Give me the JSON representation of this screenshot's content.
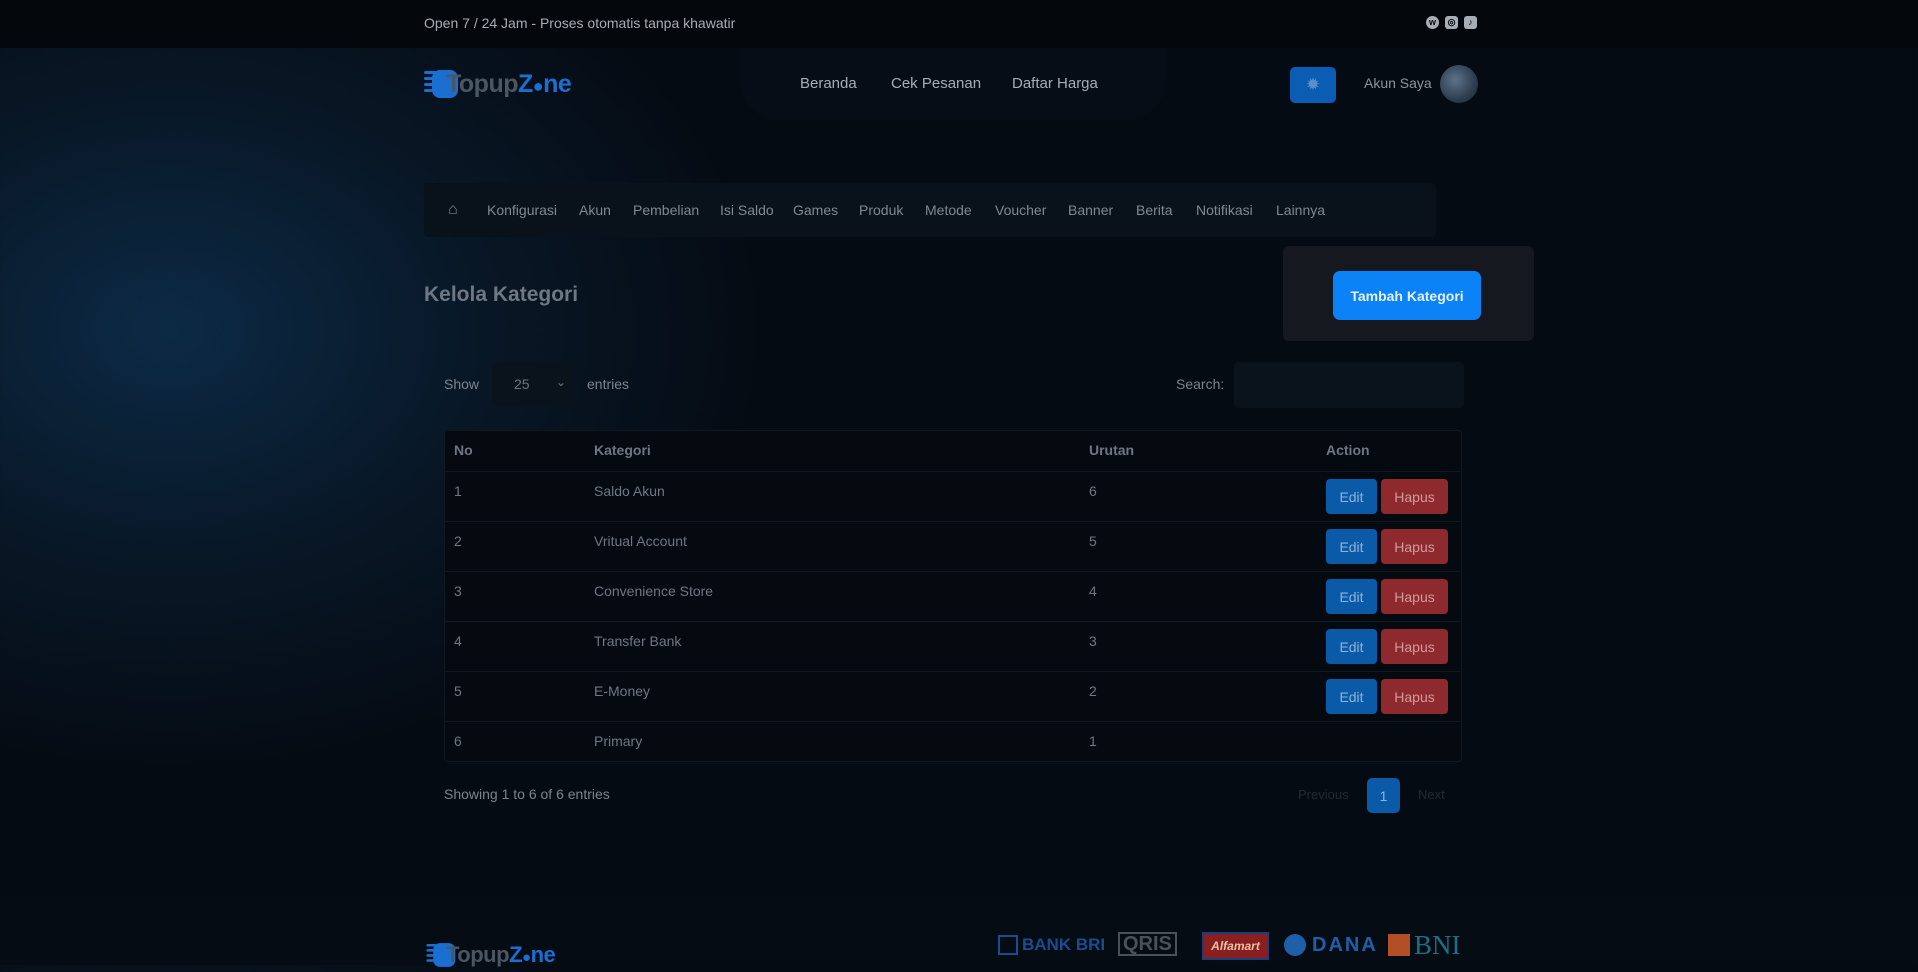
{
  "topbar": {
    "tagline": "Open 7 / 24 Jam - Proses otomatis tanpa khawatir"
  },
  "brand": {
    "name_part1": "Topup",
    "name_part2": "Z",
    "name_part3": "ne"
  },
  "nav": [
    {
      "label": "Beranda"
    },
    {
      "label": "Cek Pesanan"
    },
    {
      "label": "Daftar Harga"
    }
  ],
  "account": {
    "label": "Akun Saya"
  },
  "admin_menu": [
    "Konfigurasi",
    "Akun",
    "Pembelian",
    "Isi Saldo",
    "Games",
    "Produk",
    "Metode",
    "Voucher",
    "Banner",
    "Berita",
    "Notifikasi",
    "Lainnya"
  ],
  "page": {
    "title": "Kelola Kategori",
    "add_button": "Tambah Kategori"
  },
  "table_controls": {
    "show": "Show",
    "page_size": "25",
    "entries": "entries",
    "search": "Search:"
  },
  "table": {
    "headers": {
      "no": "No",
      "kategori": "Kategori",
      "urutan": "Urutan",
      "action": "Action"
    },
    "edit_label": "Edit",
    "delete_label": "Hapus",
    "rows": [
      {
        "no": "1",
        "kategori": "Saldo Akun",
        "urutan": "6"
      },
      {
        "no": "2",
        "kategori": "Vritual Account",
        "urutan": "5"
      },
      {
        "no": "3",
        "kategori": "Convenience Store",
        "urutan": "4"
      },
      {
        "no": "4",
        "kategori": "Transfer Bank",
        "urutan": "3"
      },
      {
        "no": "5",
        "kategori": "E-Money",
        "urutan": "2"
      },
      {
        "no": "6",
        "kategori": "Primary",
        "urutan": "1"
      }
    ]
  },
  "pagination": {
    "info": "Showing 1 to 6 of 6 entries",
    "previous": "Previous",
    "current": "1",
    "next": "Next"
  },
  "footer": {
    "payments": {
      "bri": "BANK BRI",
      "qris": "QRIS",
      "alfamart": "Alfamart",
      "dana": "DANA",
      "bni": "BNI"
    }
  },
  "colors": {
    "accent": "#0b82f6",
    "edit": "#0a5aa8",
    "delete": "#8e2a2d"
  }
}
